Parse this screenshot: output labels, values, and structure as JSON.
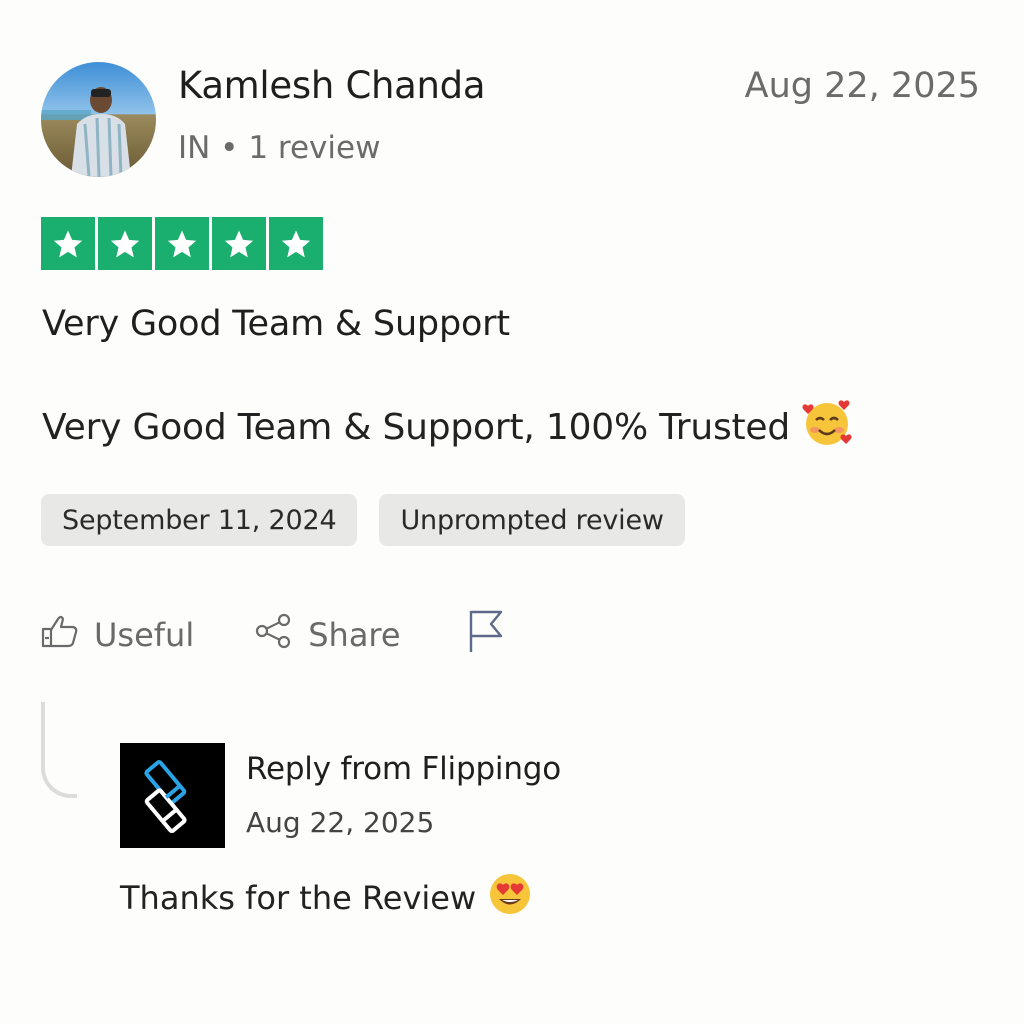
{
  "reviewer": {
    "name": "Kamlesh Chanda",
    "meta": "IN • 1 review",
    "date": "Aug 22, 2025"
  },
  "rating": {
    "stars": 5,
    "max_stars": 5,
    "color": "#1aaf6f"
  },
  "review": {
    "title": "Very Good Team & Support",
    "body": "Very Good Team & Support, 100% Trusted",
    "body_emoji": "smiling-face-with-hearts"
  },
  "chips": {
    "experience_date": "September 11, 2024",
    "review_type": "Unprompted review"
  },
  "actions": {
    "useful_label": "Useful",
    "share_label": "Share",
    "report_icon": "flag-icon"
  },
  "reply": {
    "from": "Reply from Flippingo",
    "date": "Aug 22, 2025",
    "text": "Thanks for the Review",
    "text_emoji": "heart-eyes-face"
  }
}
